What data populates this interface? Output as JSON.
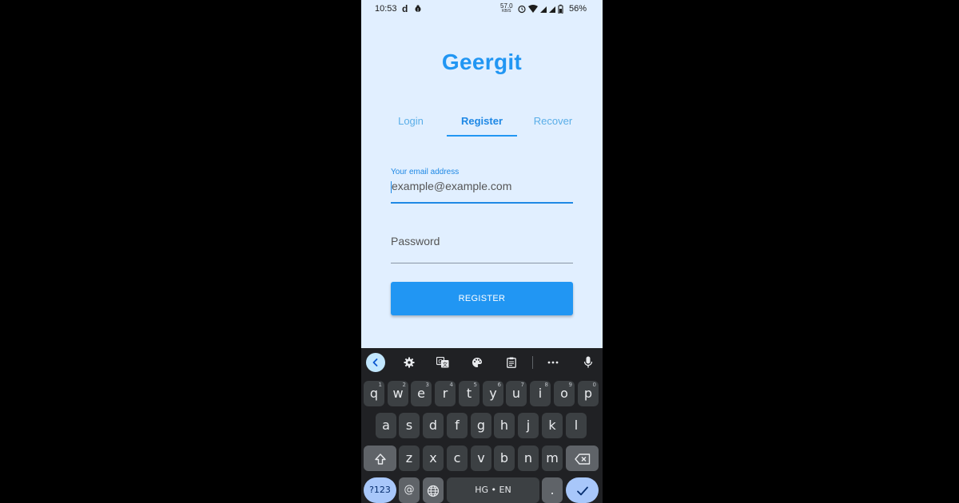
{
  "status_bar": {
    "time": "10:53",
    "d_icon": "d",
    "speed_value": "57.0",
    "speed_unit": "KB/S",
    "battery": "56%",
    "icons": [
      "alarm-icon",
      "wifi-icon",
      "signal-icon",
      "signal-icon",
      "battery-icon"
    ]
  },
  "app": {
    "title": "Geergit",
    "tabs": [
      {
        "label": "Login"
      },
      {
        "label": "Register"
      },
      {
        "label": "Recover"
      }
    ],
    "active_tab": "Register",
    "email": {
      "label": "Your email address",
      "placeholder": "example@example.com"
    },
    "password": {
      "placeholder": "Password"
    },
    "register_label": "REGISTER",
    "accent_color": "#2196f3",
    "background_color": "#e1efff"
  },
  "keyboard": {
    "toolbar_icons": [
      "back-icon",
      "gear-icon",
      "translate-icon",
      "palette-icon",
      "clipboard-icon",
      "more-icon",
      "mic-icon"
    ],
    "row1": [
      {
        "label": "q",
        "hint": "1"
      },
      {
        "label": "w",
        "hint": "2"
      },
      {
        "label": "e",
        "hint": "3"
      },
      {
        "label": "r",
        "hint": "4"
      },
      {
        "label": "t",
        "hint": "5"
      },
      {
        "label": "y",
        "hint": "6"
      },
      {
        "label": "u",
        "hint": "7"
      },
      {
        "label": "i",
        "hint": "8"
      },
      {
        "label": "o",
        "hint": "9"
      },
      {
        "label": "p",
        "hint": "0"
      }
    ],
    "row2": [
      "a",
      "s",
      "d",
      "f",
      "g",
      "h",
      "j",
      "k",
      "l"
    ],
    "row3": [
      "z",
      "x",
      "c",
      "v",
      "b",
      "n",
      "m"
    ],
    "sym_label": "?123",
    "at_label": "@",
    "space_label": "HG • EN",
    "period_label": "."
  }
}
